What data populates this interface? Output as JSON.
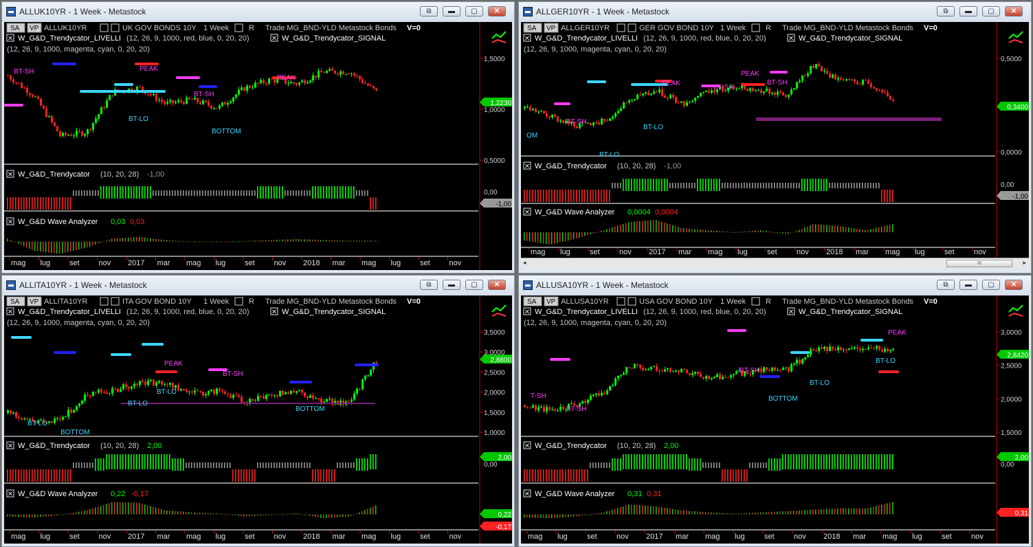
{
  "common": {
    "sa_label": "SA",
    "vp_label": "VP",
    "period": "1 Week",
    "r_label": "R",
    "trade_info": "Trade  MG_BND-YLD  Metastock  Bonds",
    "v_label": "V=0",
    "livelli_label": "W_G&D_Trendycator_LIVELLI",
    "livelli_params": "(12, 26, 9, 1000, red, blue, 0, 20, 20)",
    "signal_label": "W_G&D_Trendycator_SIGNAL",
    "signal_params": "(12, 26, 9, 1000, magenta, cyan, 0, 20, 20)",
    "trendy_label": "W_G&D_Trendycator",
    "trendy_params": "(10, 20, 28)",
    "wave_label": "W_G&D Wave Analyzer",
    "restore_glyph": "⧉",
    "min_glyph": "▬",
    "max_glyph": "▢",
    "close_glyph": "✕",
    "close_box_glyph": "✕",
    "scroll_left": "◂",
    "scroll_right": "▸",
    "scroll_grip": "III"
  },
  "windows": [
    {
      "title": "ALLUK10YR - 1 Week - Metastock",
      "symbol": "ALLUK10YR",
      "desc": "UK GOV BONDS 10Y",
      "price_ticks": [
        "1,5000",
        "1,0000",
        "0,5000"
      ],
      "price_tag": "1,2230",
      "trendy_value": "-1,00",
      "trendy_ticks": [
        "0,00"
      ],
      "trendy_tag": "-1,00",
      "wave_v1": "0,03",
      "wave_v2": "0,03",
      "wave_tags": [],
      "date_labels": [
        "mag",
        "lug",
        "set",
        "nov",
        "2017",
        "mar",
        "mag",
        "lug",
        "set",
        "nov",
        "2018",
        "mar",
        "mag",
        "lug",
        "set",
        "nov"
      ],
      "annotations": [
        {
          "text": "BT-SH",
          "color": "#ff3cff"
        },
        {
          "text": "PEAK",
          "color": "#ff3cff"
        },
        {
          "text": "BT-SH",
          "color": "#ff3cff"
        },
        {
          "text": "PEAK",
          "color": "#ff3cff"
        },
        {
          "text": "BT-LO",
          "color": "#3cd7ff"
        },
        {
          "text": "BOTTOM",
          "color": "#3cd7ff"
        }
      ]
    },
    {
      "title": "ALLGER10YR - 1 Week - Metastock",
      "symbol": "ALLGER10YR",
      "desc": "GER GOV BOND 10Y",
      "price_ticks": [
        "0,5000",
        "0,0000"
      ],
      "price_tag": "0,3400",
      "trendy_value": "-1,00",
      "trendy_ticks": [
        "0,00"
      ],
      "trendy_tag": "-1,00",
      "wave_v1": "0,0004",
      "wave_v2": "0,0004",
      "wave_tags": [],
      "date_labels": [
        "mag",
        "lug",
        "set",
        "nov",
        "2017",
        "mar",
        "mag",
        "lug",
        "set",
        "nov",
        "2018",
        "mar",
        "mag",
        "lug",
        "set",
        "nov"
      ],
      "annotations": [
        {
          "text": "PEAK",
          "color": "#ff3cff"
        },
        {
          "text": "PEAK",
          "color": "#ff3cff"
        },
        {
          "text": "BT-SH",
          "color": "#ff3cff"
        },
        {
          "text": "BT-SH",
          "color": "#ff3cff"
        },
        {
          "text": "BT-SH",
          "color": "#ff3cff"
        },
        {
          "text": "OM",
          "color": "#3cd7ff"
        },
        {
          "text": "BT-LO",
          "color": "#3cd7ff"
        },
        {
          "text": "BT-LO",
          "color": "#3cd7ff"
        }
      ]
    },
    {
      "title": "ALLITA10YR - 1 Week - Metastock",
      "symbol": "ALLITA10YR",
      "desc": "ITA GOV BOND 10Y",
      "price_ticks": [
        "3,5000",
        "3,0000",
        "2,5000",
        "2,0000",
        "1,5000",
        "1,0000"
      ],
      "price_tag": "2,8800",
      "trendy_value": "2,00",
      "trendy_ticks": [
        "0,00"
      ],
      "trendy_tag": "2,00",
      "wave_v1": "0,22",
      "wave_v2": "-0,17",
      "wave_tags": [
        "0,22",
        "-0,17"
      ],
      "date_labels": [
        "mag",
        "lug",
        "set",
        "nov",
        "2017",
        "mar",
        "mag",
        "lug",
        "set",
        "nov",
        "2018",
        "mar",
        "mag",
        "lug",
        "set",
        "nov"
      ],
      "annotations": [
        {
          "text": "PEAK",
          "color": "#ff3cff"
        },
        {
          "text": "BT-SH",
          "color": "#ff3cff"
        },
        {
          "text": "BT-LO",
          "color": "#3cd7ff"
        },
        {
          "text": "BT-LO",
          "color": "#3cd7ff"
        },
        {
          "text": "BT-LO",
          "color": "#3cd7ff"
        },
        {
          "text": "BOTTOM",
          "color": "#3cd7ff"
        },
        {
          "text": "BOTTOM",
          "color": "#3cd7ff"
        }
      ]
    },
    {
      "title": "ALLUSA10YR - 1 Week - Metastock",
      "symbol": "ALLUSA10YR",
      "desc": "USA GOV BOND 10Y",
      "price_ticks": [
        "3,0000",
        "2,5000",
        "2,0000",
        "1,5000"
      ],
      "price_tag": "2,8420",
      "trendy_value": "2,00",
      "trendy_ticks": [
        "0,00"
      ],
      "trendy_tag": "2,00",
      "wave_v1": "0,31",
      "wave_v2": "0,31",
      "wave_tags": [
        "0,31"
      ],
      "date_labels": [
        "mag",
        "lug",
        "set",
        "nov",
        "2017",
        "mar",
        "mag",
        "lug",
        "set",
        "nov",
        "2018",
        "mar",
        "mag",
        "lug",
        "set",
        "nov"
      ],
      "annotations": [
        {
          "text": "T-SH",
          "color": "#ff3cff"
        },
        {
          "text": "BT-SH",
          "color": "#ff3cff"
        },
        {
          "text": "BT-SH",
          "color": "#ff3cff"
        },
        {
          "text": "PEAK",
          "color": "#ff3cff"
        },
        {
          "text": "BOTTOM",
          "color": "#3cd7ff"
        },
        {
          "text": "BT-LO",
          "color": "#3cd7ff"
        },
        {
          "text": "BT-LO",
          "color": "#3cd7ff"
        }
      ]
    }
  ],
  "chart_data": [
    {
      "type": "candlestick",
      "title": "ALLUK10YR - 1 Week - Metastock",
      "x": [
        "mag",
        "lug",
        "set",
        "nov",
        "2017",
        "mar",
        "mag",
        "lug",
        "set",
        "nov",
        "2018",
        "mar",
        "mag"
      ],
      "values": [
        1.45,
        1.2,
        0.7,
        0.75,
        1.25,
        1.3,
        1.1,
        1.15,
        1.05,
        1.3,
        1.4,
        1.35,
        1.5,
        1.5,
        1.25
      ],
      "ylim": [
        0.4,
        1.7
      ],
      "series": [
        {
          "name": "W_G&D_Trendycator",
          "values": [
            -1,
            -1,
            -1,
            0,
            1,
            1,
            0,
            0,
            0,
            0,
            1,
            0,
            1,
            1,
            -1
          ]
        },
        {
          "name": "W_G&D Wave Analyzer",
          "values": [
            0.1,
            -0.3,
            -0.4,
            -0.2,
            0.1,
            0.15,
            0.05,
            0.0,
            -0.02,
            0.02,
            0.05,
            0.08,
            0.05,
            0.03,
            0.03
          ]
        }
      ]
    },
    {
      "type": "candlestick",
      "title": "ALLGER10YR - 1 Week - Metastock",
      "x": [
        "mag",
        "lug",
        "set",
        "nov",
        "2017",
        "mar",
        "mag",
        "lug",
        "set",
        "nov",
        "2018",
        "mar",
        "mag"
      ],
      "values": [
        0.25,
        0.15,
        0.05,
        0.1,
        0.35,
        0.45,
        0.3,
        0.45,
        0.5,
        0.45,
        0.4,
        0.75,
        0.55,
        0.55,
        0.34
      ],
      "ylim": [
        -0.25,
        0.85
      ],
      "series": [
        {
          "name": "W_G&D_Trendycator",
          "values": [
            -1,
            -1,
            -1,
            -1,
            1,
            1,
            0,
            1,
            0,
            0,
            0,
            1,
            0,
            0,
            -1
          ]
        },
        {
          "name": "W_G&D Wave Analyzer",
          "values": [
            -0.0004,
            -0.0006,
            -0.0003,
            0.0001,
            0.0005,
            0.0006,
            0.0002,
            0.0001,
            0.0,
            0.0001,
            -0.0001,
            0.0004,
            0.0003,
            0.0001,
            0.0004
          ]
        }
      ]
    },
    {
      "type": "candlestick",
      "title": "ALLITA10YR - 1 Week - Metastock",
      "x": [
        "mag",
        "lug",
        "set",
        "nov",
        "2017",
        "mar",
        "mag",
        "lug",
        "set",
        "nov",
        "2018",
        "mar",
        "mag"
      ],
      "values": [
        1.5,
        1.3,
        1.3,
        2.0,
        2.1,
        2.3,
        2.3,
        2.0,
        2.1,
        1.8,
        2.0,
        2.05,
        1.8,
        1.8,
        2.88
      ],
      "ylim": [
        1.0,
        3.7
      ],
      "series": [
        {
          "name": "W_G&D_Trendycator",
          "values": [
            -1,
            -1,
            -1,
            0,
            2,
            2,
            2,
            0,
            0,
            -1,
            0,
            0,
            -1,
            0,
            2
          ]
        },
        {
          "name": "W_G&D Wave Analyzer",
          "values": [
            -0.05,
            -0.08,
            -0.02,
            0.1,
            0.3,
            0.28,
            0.1,
            0.05,
            0.02,
            -0.05,
            -0.02,
            0.03,
            -0.1,
            -0.05,
            0.22
          ]
        }
      ]
    },
    {
      "type": "candlestick",
      "title": "ALLUSA10YR - 1 Week - Metastock",
      "x": [
        "mag",
        "lug",
        "set",
        "nov",
        "2017",
        "mar",
        "mag",
        "lug",
        "set",
        "nov",
        "2018",
        "mar",
        "mag"
      ],
      "values": [
        1.6,
        1.5,
        1.6,
        1.9,
        2.5,
        2.4,
        2.4,
        2.2,
        2.3,
        2.4,
        2.4,
        2.85,
        2.9,
        2.9,
        2.84
      ],
      "ylim": [
        1.0,
        3.3
      ],
      "series": [
        {
          "name": "W_G&D_Trendycator",
          "values": [
            -1,
            -1,
            -1,
            0,
            2,
            2,
            2,
            0,
            -1,
            0,
            2,
            2,
            2,
            2,
            2
          ]
        },
        {
          "name": "W_G&D Wave Analyzer",
          "values": [
            -0.08,
            -0.1,
            -0.05,
            0.05,
            0.25,
            0.2,
            0.1,
            0.05,
            0.02,
            0.05,
            0.08,
            0.12,
            0.15,
            0.15,
            0.31
          ]
        }
      ]
    }
  ]
}
